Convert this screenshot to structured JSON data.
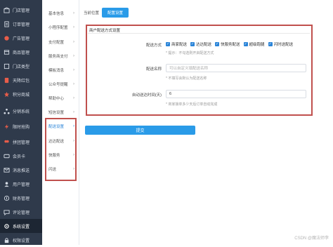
{
  "sidebar": {
    "items": [
      {
        "label": "门店管理",
        "icon": "store-icon"
      },
      {
        "label": "订单管理",
        "icon": "order-icon"
      },
      {
        "label": "广告管理",
        "icon": "ad-icon"
      },
      {
        "label": "商品管理",
        "icon": "goods-icon"
      },
      {
        "label": "门店类型",
        "icon": "store-type-icon"
      },
      {
        "label": "天降红包",
        "icon": "red-packet-icon"
      },
      {
        "label": "积分商城",
        "icon": "points-mall-icon"
      },
      {
        "label": "分销系统",
        "icon": "distribution-icon"
      },
      {
        "label": "限时抢购",
        "icon": "flash-sale-icon"
      },
      {
        "label": "拼团管理",
        "icon": "group-buy-icon"
      },
      {
        "label": "会员卡",
        "icon": "member-card-icon"
      },
      {
        "label": "消息推送",
        "icon": "message-icon"
      },
      {
        "label": "用户管理",
        "icon": "user-icon"
      },
      {
        "label": "财务管理",
        "icon": "finance-icon"
      },
      {
        "label": "评论管理",
        "icon": "comment-icon"
      },
      {
        "label": "系统设置",
        "icon": "settings-icon"
      },
      {
        "label": "权限设置",
        "icon": "permission-icon"
      }
    ],
    "active_index": 15
  },
  "submenu": {
    "items": [
      {
        "label": "基本信息"
      },
      {
        "label": "小程序配置"
      },
      {
        "label": "支付配置"
      },
      {
        "label": "服务商支付"
      },
      {
        "label": "模板消息"
      },
      {
        "label": "公众号提醒"
      },
      {
        "label": "帮助中心"
      },
      {
        "label": "短信设置"
      },
      {
        "label": "配送设置"
      },
      {
        "label": "达达配送"
      },
      {
        "label": "快服务"
      },
      {
        "label": "闪送"
      }
    ],
    "active_index": 8
  },
  "topbar": {
    "crumb": "当前位置",
    "button": "配置设置"
  },
  "form": {
    "section_title": "商户配送方式设置",
    "delivery_label": "配送方式",
    "delivery_options": [
      "商家配送",
      "达达配送",
      "快服务配送",
      "超级跑腿",
      "闪时送配送"
    ],
    "delivery_hint": "* 提示：不勾选则开启配送方式",
    "name_label": "配送名称",
    "name_placeholder": "可以自定义填配送名称",
    "name_hint": "* 不填写会默认为配送名称",
    "time_label": "自动送达时间(天)",
    "time_value": "6",
    "time_hint": "* 商家接单多少天后订单自动完成"
  },
  "submit_label": "提交",
  "watermark": "CSDN @魔法师李"
}
